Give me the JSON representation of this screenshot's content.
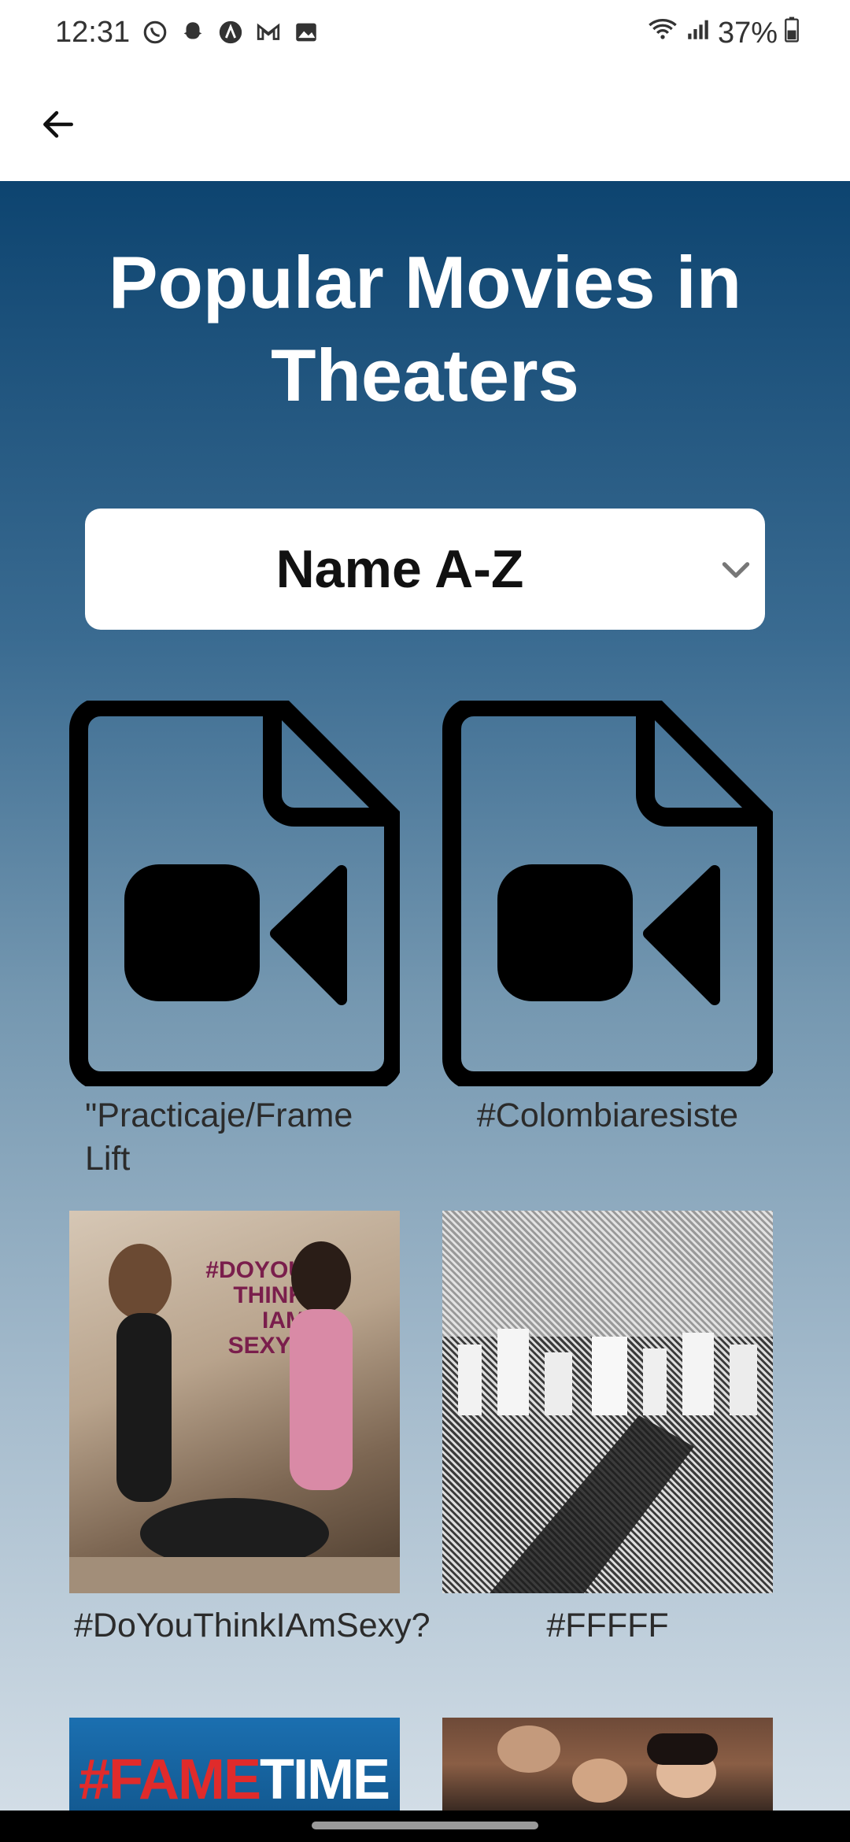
{
  "status_bar": {
    "time": "12:31",
    "battery": "37%",
    "notification_icons": [
      "whatsapp-icon",
      "snapchat-icon",
      "app-icon",
      "gmail-icon",
      "gallery-icon"
    ]
  },
  "app_bar": {
    "back_icon": "arrow-left-icon"
  },
  "main": {
    "title": "Popular Movies in Theaters",
    "sort": {
      "selected": "Name A-Z"
    },
    "movies": [
      {
        "title": "\"Practicaje/Frame Lift",
        "image": "video-file-icon"
      },
      {
        "title": "#Colombiaresiste",
        "image": "video-file-icon"
      },
      {
        "title": "#DoYouThinkIAmSexy?",
        "image": "poster",
        "poster_text": "#DOYOU THINK IAM SEXY?"
      },
      {
        "title": "#FFFFF",
        "image": "poster"
      },
      {
        "title": "",
        "image": "poster",
        "poster_text_1": "#FAME",
        "poster_text_2": "TIME"
      },
      {
        "title": "",
        "image": "poster"
      }
    ]
  },
  "colors": {
    "gradient_top": "#0d4470",
    "gradient_bottom": "#d2dde6",
    "title": "#ffffff"
  }
}
